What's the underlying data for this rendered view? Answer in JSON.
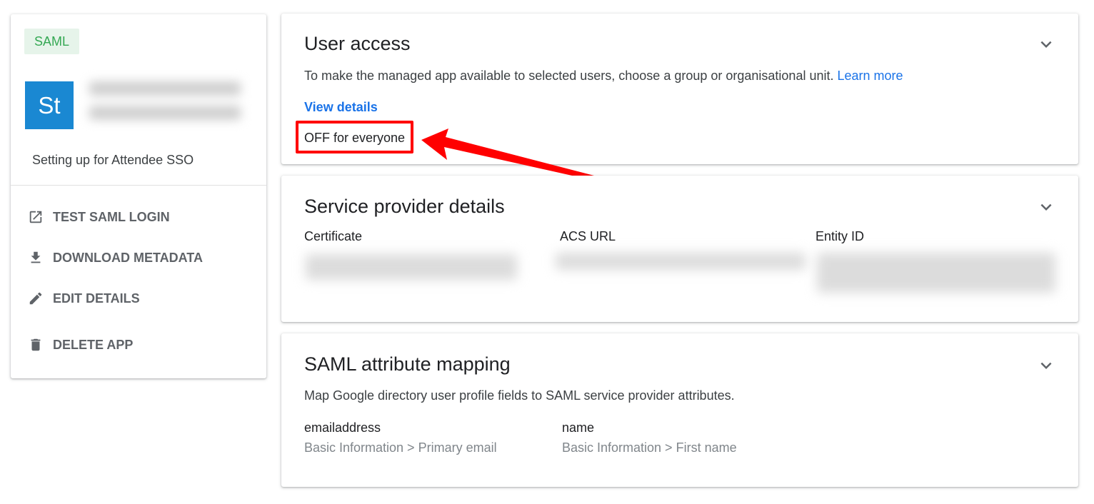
{
  "app_card": {
    "badge": "SAML",
    "avatar_initials": "St",
    "description": "Setting up for Attendee SSO",
    "actions": [
      {
        "label": "TEST SAML LOGIN",
        "icon": "open-in-new-icon"
      },
      {
        "label": "DOWNLOAD METADATA",
        "icon": "download-icon"
      },
      {
        "label": "EDIT DETAILS",
        "icon": "pencil-icon"
      },
      {
        "label": "DELETE APP",
        "icon": "trash-icon"
      }
    ]
  },
  "user_access": {
    "title": "User access",
    "description": "To make the managed app available to selected users, choose a group or organisational unit.",
    "learn_more": "Learn more",
    "view_details": "View details",
    "status": "OFF for everyone"
  },
  "service_provider": {
    "title": "Service provider details",
    "columns": [
      "Certificate",
      "ACS URL",
      "Entity ID"
    ]
  },
  "attribute_mapping": {
    "title": "SAML attribute mapping",
    "description": "Map Google directory user profile fields to SAML service provider attributes.",
    "mappings": [
      {
        "attribute": "emailaddress",
        "source": "Basic Information > Primary email"
      },
      {
        "attribute": "name",
        "source": "Basic Information > First name"
      }
    ]
  },
  "colors": {
    "accent": "#1a73e8",
    "badge_bg": "#e6f4ea",
    "badge_text": "#34a853",
    "avatar_bg": "#1a88d2",
    "annotation": "#ff0000"
  }
}
